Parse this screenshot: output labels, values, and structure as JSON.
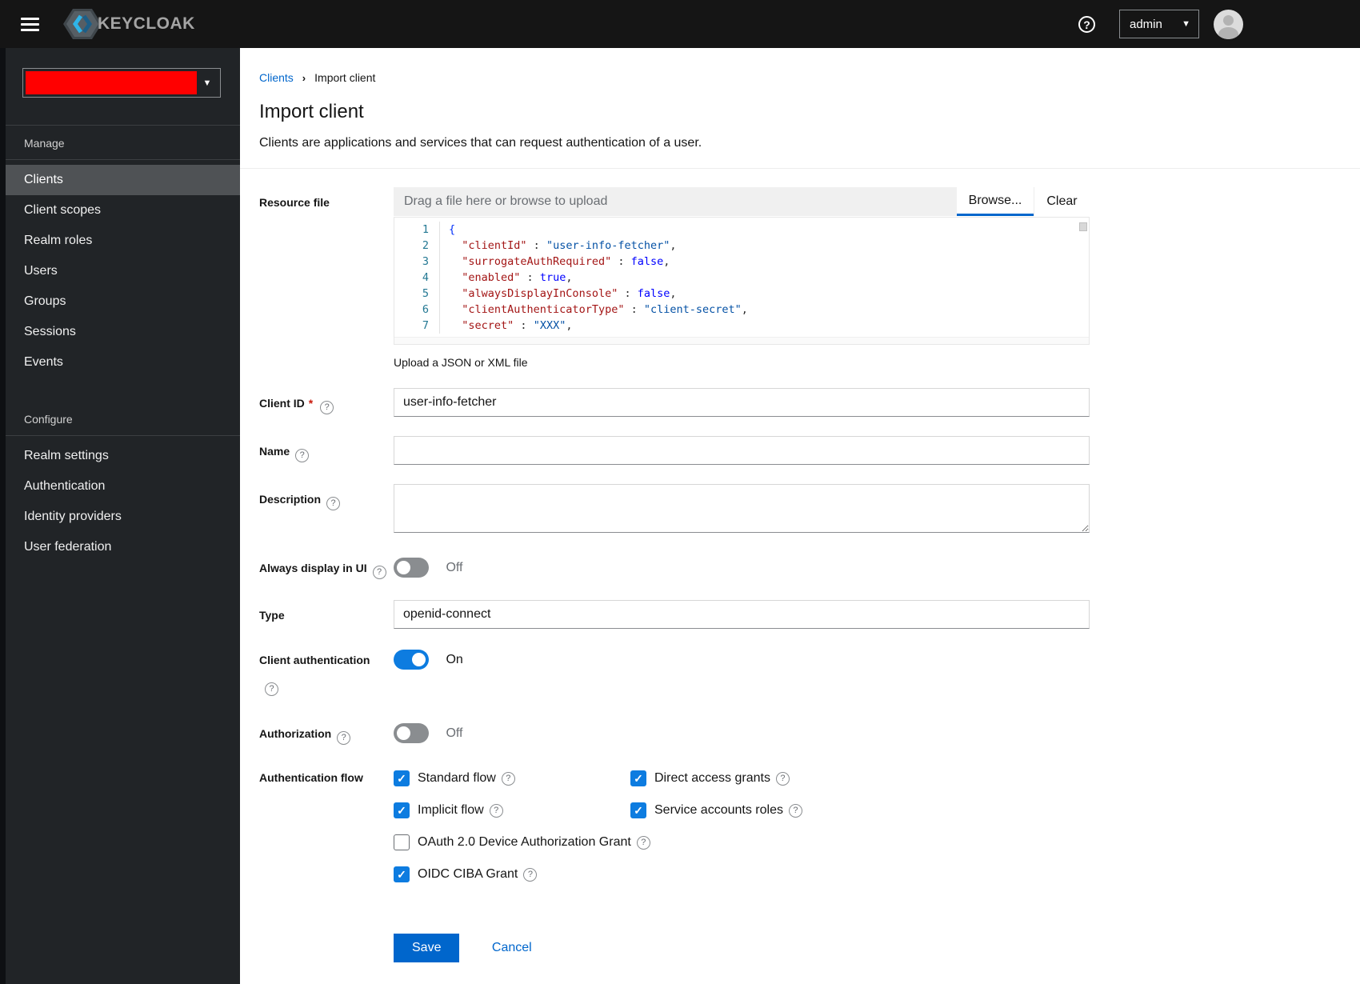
{
  "masthead": {
    "brand": "KEYCLOAK",
    "username": "admin"
  },
  "sidebar": {
    "sections": [
      {
        "title": "Manage",
        "items": [
          {
            "label": "Clients",
            "active": true
          },
          {
            "label": "Client scopes",
            "active": false
          },
          {
            "label": "Realm roles",
            "active": false
          },
          {
            "label": "Users",
            "active": false
          },
          {
            "label": "Groups",
            "active": false
          },
          {
            "label": "Sessions",
            "active": false
          },
          {
            "label": "Events",
            "active": false
          }
        ]
      },
      {
        "title": "Configure",
        "items": [
          {
            "label": "Realm settings",
            "active": false
          },
          {
            "label": "Authentication",
            "active": false
          },
          {
            "label": "Identity providers",
            "active": false
          },
          {
            "label": "User federation",
            "active": false
          }
        ]
      }
    ]
  },
  "breadcrumb": {
    "link": "Clients",
    "current": "Import client"
  },
  "page": {
    "title": "Import client",
    "subtitle": "Clients are applications and services that can request authentication of a user."
  },
  "form": {
    "resource_file": {
      "label": "Resource file",
      "placeholder": "Drag a file here or browse to upload",
      "browse_label": "Browse...",
      "clear_label": "Clear",
      "helper": "Upload a JSON or XML file",
      "code_lines": [
        {
          "n": "1",
          "tokens": [
            {
              "c": "br",
              "t": "{"
            }
          ]
        },
        {
          "n": "2",
          "tokens": [
            {
              "c": "p",
              "t": "  "
            },
            {
              "c": "k",
              "t": "\"clientId\""
            },
            {
              "c": "p",
              "t": " : "
            },
            {
              "c": "s",
              "t": "\"user-info-fetcher\""
            },
            {
              "c": "p",
              "t": ","
            }
          ]
        },
        {
          "n": "3",
          "tokens": [
            {
              "c": "p",
              "t": "  "
            },
            {
              "c": "k",
              "t": "\"surrogateAuthRequired\""
            },
            {
              "c": "p",
              "t": " : "
            },
            {
              "c": "b",
              "t": "false"
            },
            {
              "c": "p",
              "t": ","
            }
          ]
        },
        {
          "n": "4",
          "tokens": [
            {
              "c": "p",
              "t": "  "
            },
            {
              "c": "k",
              "t": "\"enabled\""
            },
            {
              "c": "p",
              "t": " : "
            },
            {
              "c": "b",
              "t": "true"
            },
            {
              "c": "p",
              "t": ","
            }
          ]
        },
        {
          "n": "5",
          "tokens": [
            {
              "c": "p",
              "t": "  "
            },
            {
              "c": "k",
              "t": "\"alwaysDisplayInConsole\""
            },
            {
              "c": "p",
              "t": " : "
            },
            {
              "c": "b",
              "t": "false"
            },
            {
              "c": "p",
              "t": ","
            }
          ]
        },
        {
          "n": "6",
          "tokens": [
            {
              "c": "p",
              "t": "  "
            },
            {
              "c": "k",
              "t": "\"clientAuthenticatorType\""
            },
            {
              "c": "p",
              "t": " : "
            },
            {
              "c": "s",
              "t": "\"client-secret\""
            },
            {
              "c": "p",
              "t": ","
            }
          ]
        },
        {
          "n": "7",
          "tokens": [
            {
              "c": "p",
              "t": "  "
            },
            {
              "c": "k",
              "t": "\"secret\""
            },
            {
              "c": "p",
              "t": " : "
            },
            {
              "c": "s",
              "t": "\"XXX\""
            },
            {
              "c": "p",
              "t": ","
            }
          ]
        }
      ]
    },
    "client_id": {
      "label": "Client ID",
      "required_marker": "*",
      "value": "user-info-fetcher"
    },
    "name": {
      "label": "Name",
      "value": ""
    },
    "description": {
      "label": "Description",
      "value": ""
    },
    "always_display": {
      "label": "Always display in UI",
      "state": "Off"
    },
    "type": {
      "label": "Type",
      "value": "openid-connect"
    },
    "client_auth": {
      "label": "Client authentication",
      "state": "On"
    },
    "authorization": {
      "label": "Authorization",
      "state": "Off"
    },
    "auth_flow": {
      "label": "Authentication flow",
      "checkboxes": [
        {
          "label": "Standard flow",
          "checked": true
        },
        {
          "label": "Direct access grants",
          "checked": true
        },
        {
          "label": "Implicit flow",
          "checked": true
        },
        {
          "label": "Service accounts roles",
          "checked": true
        },
        {
          "label": "OAuth 2.0 Device Authorization Grant",
          "checked": false
        },
        {
          "label": "OIDC CIBA Grant",
          "checked": true
        }
      ]
    },
    "actions": {
      "save": "Save",
      "cancel": "Cancel"
    }
  },
  "colors": {
    "accent": "#0066cc",
    "control_blue": "#0d7ce0",
    "masthead_bg": "#151515",
    "sidebar_bg": "#212427",
    "sidebar_active_bg": "#4f5255",
    "sidebar_active_border": "#2b9af3",
    "realm_redacted": "#ff0000",
    "code_key": "#a31515",
    "code_string": "#0451a5",
    "code_boolean": "#0000ff",
    "code_brace": "#0431fa",
    "code_linenum": "#237893"
  }
}
